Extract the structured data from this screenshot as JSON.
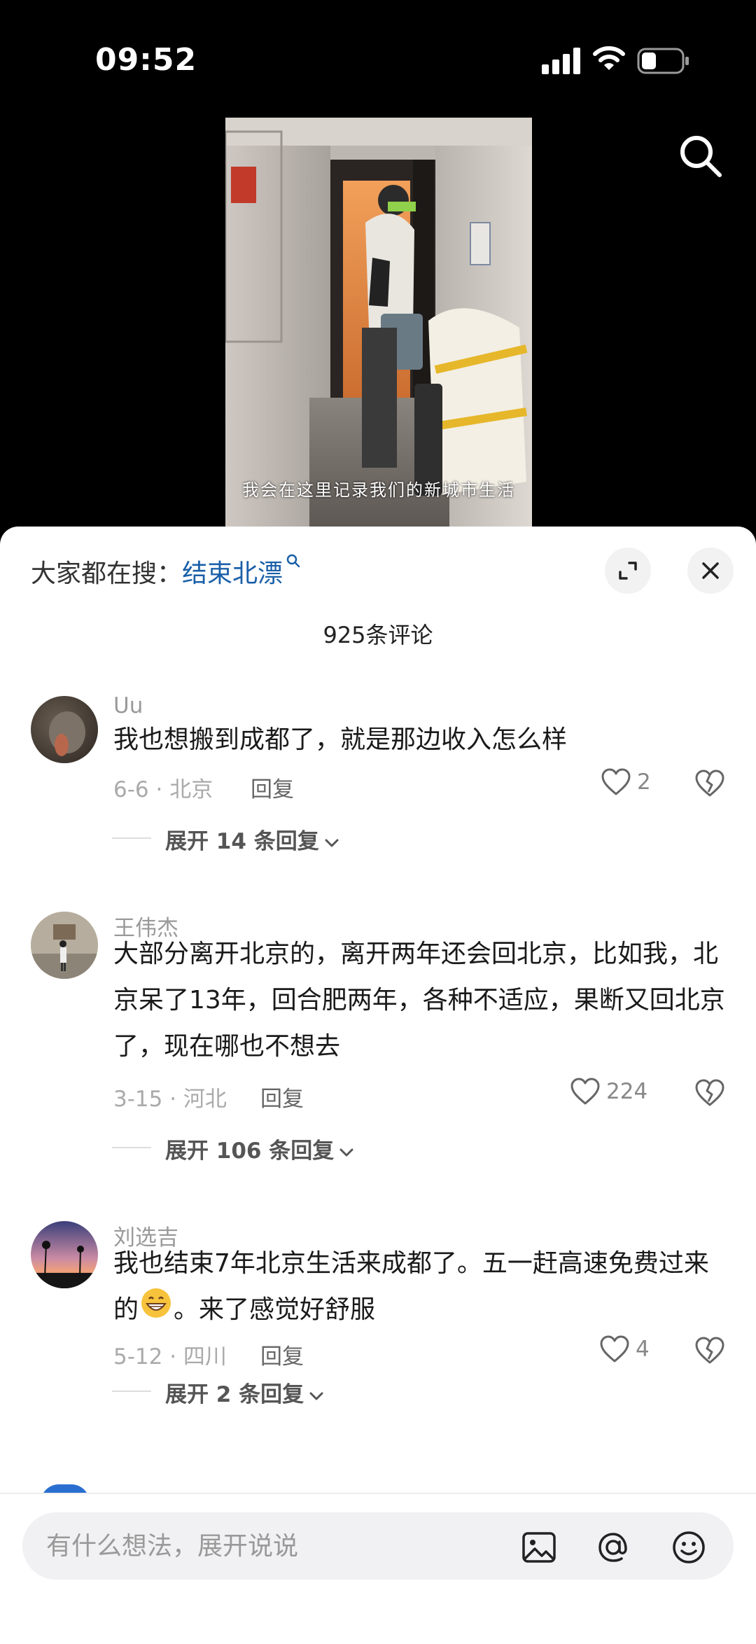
{
  "status": {
    "time": "09:52"
  },
  "video": {
    "caption": "我会在这里记录我们的新城市生活"
  },
  "comments_sheet": {
    "hot_search_prefix": "大家都在搜：",
    "hot_search_keyword": "结束北漂",
    "count_label": "925条评论",
    "reply_label": "回复",
    "comments": [
      {
        "user": "Uu",
        "text": "我也想搬到成都了，就是那边收入怎么样",
        "meta": "6-6 · 北京",
        "likes": "2",
        "expand_label": "展开 14 条回复"
      },
      {
        "user": "王伟杰",
        "text": "大部分离开北京的，离开两年还会回北京，比如我，北京呆了13年，回合肥两年，各种不适应，果断又回北京了，现在哪也不想去",
        "meta": "3-15 · 河北",
        "likes": "224",
        "expand_label": "展开 106 条回复"
      },
      {
        "user": "刘选吉",
        "text_before_emoji": "我也结束7年北京生活来成都了。五一赶高速免费过来的",
        "text_after_emoji": "。来了感觉好舒服",
        "meta": "5-12 · 四川",
        "likes": "4",
        "expand_label": "展开 2 条回复"
      }
    ],
    "input_placeholder": "有什么想法，展开说说"
  },
  "icons": [
    "search-icon",
    "expand-icon",
    "close-icon",
    "heart-icon",
    "broken-heart-icon",
    "chevron-down-icon",
    "image-icon",
    "at-icon",
    "emoji-icon"
  ],
  "colors": {
    "keyword_blue": "#1a5fa8",
    "sheet_bg": "#ffffff",
    "input_bg": "#f1f1f3"
  }
}
